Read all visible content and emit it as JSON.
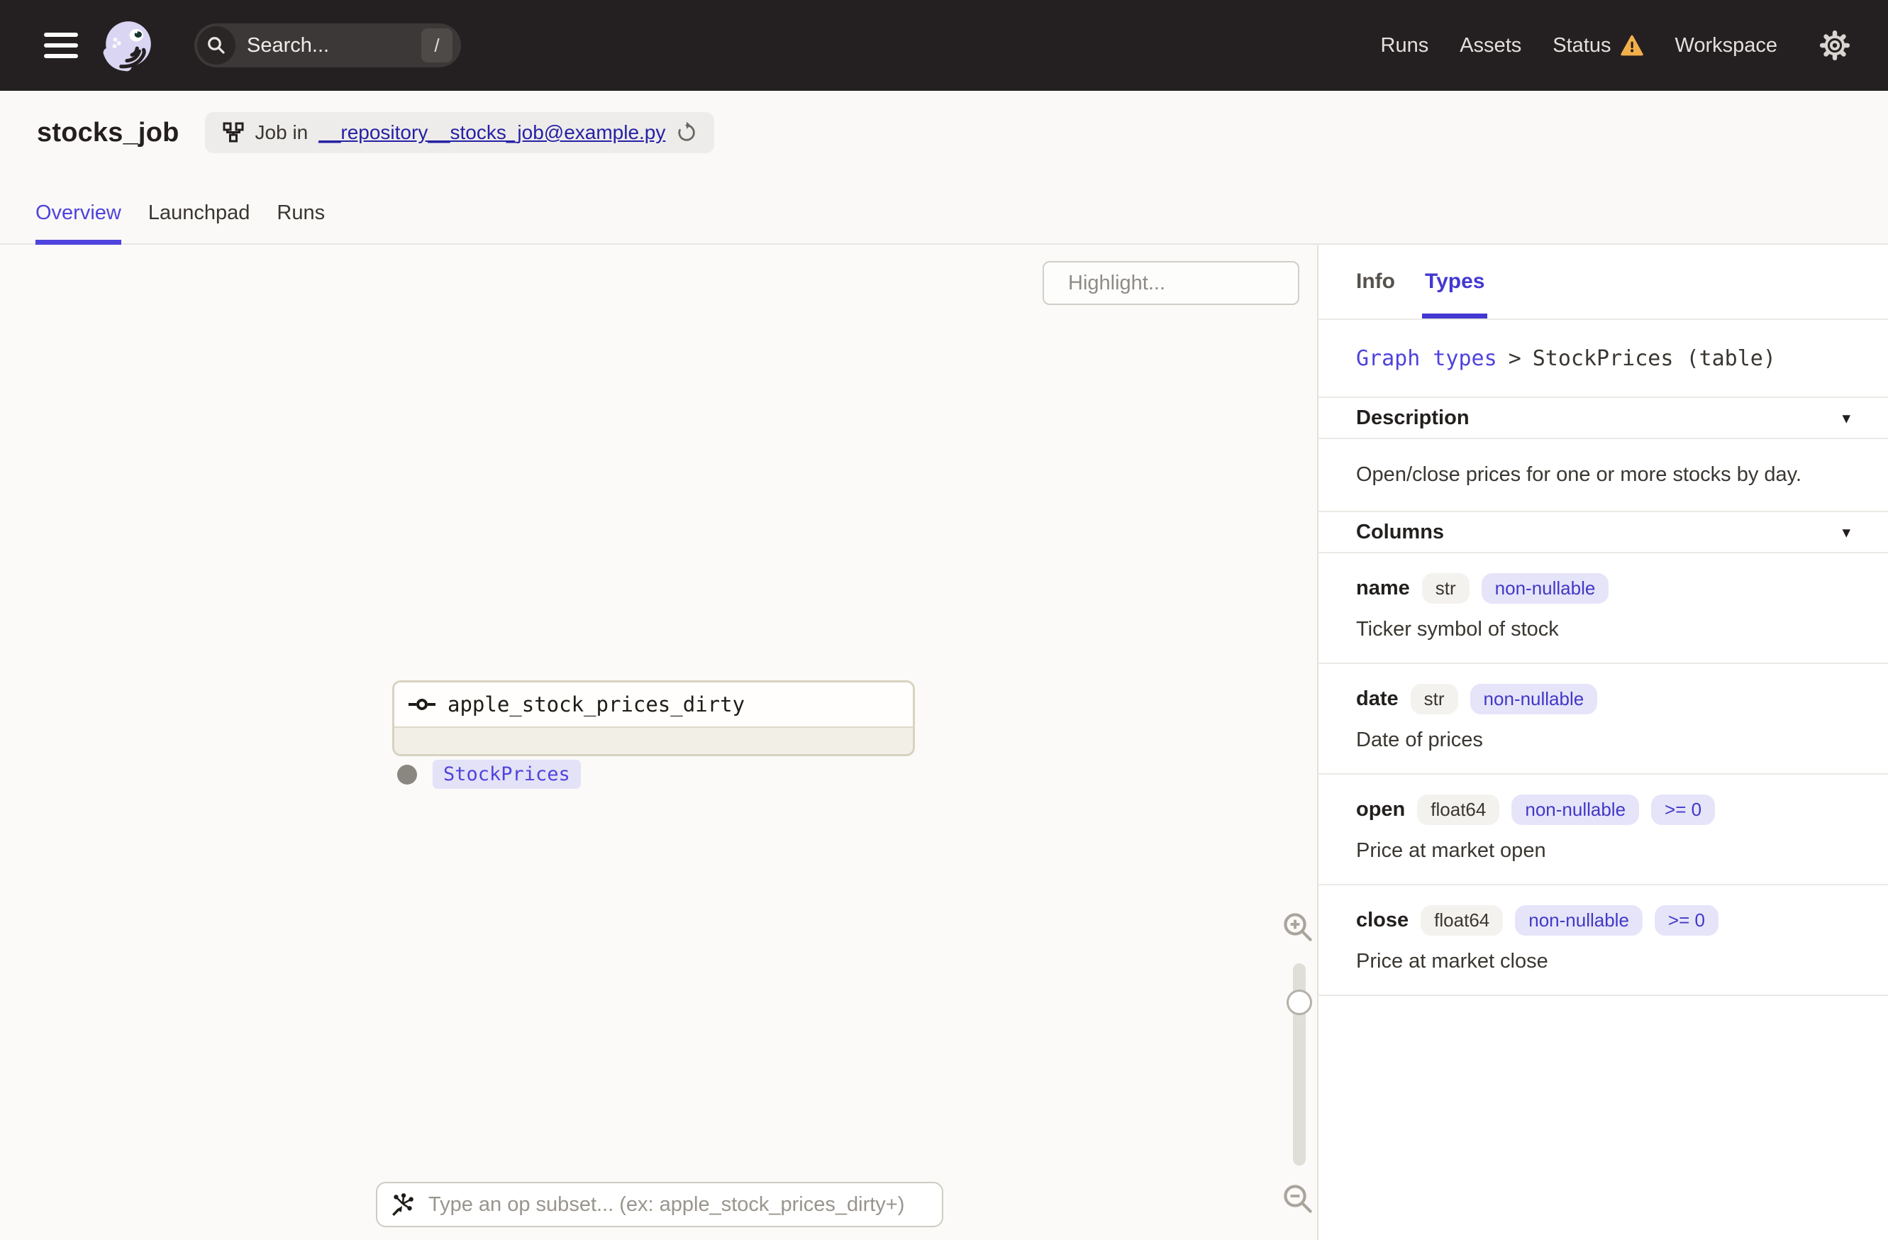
{
  "colors": {
    "accent": "#4F43DD",
    "warning": "#F2B04A",
    "nav_bg": "#242021",
    "link": "#2721A5"
  },
  "nav": {
    "search": {
      "placeholder": "Search...",
      "shortcut_key": "/"
    },
    "items": [
      {
        "label": "Runs"
      },
      {
        "label": "Assets"
      },
      {
        "label": "Status",
        "has_warning": true
      },
      {
        "label": "Workspace"
      }
    ]
  },
  "header": {
    "title": "stocks_job",
    "job": {
      "prefix": "Job in",
      "link": "__repository__stocks_job@example.py"
    },
    "tabs": [
      {
        "label": "Overview",
        "active": true
      },
      {
        "label": "Launchpad",
        "active": false
      },
      {
        "label": "Runs",
        "active": false
      }
    ]
  },
  "canvas": {
    "highlight": {
      "placeholder": "Highlight..."
    },
    "node": {
      "title": "apple_stock_prices_dirty",
      "output_type": "StockPrices"
    },
    "op_subset": {
      "placeholder": "Type an op subset... (ex: apple_stock_prices_dirty+)"
    }
  },
  "panel": {
    "tabs": [
      {
        "label": "Info",
        "active": false
      },
      {
        "label": "Types",
        "active": true
      }
    ],
    "breadcrumb": {
      "link": "Graph types",
      "separator": ">",
      "current": "StockPrices (table)"
    },
    "description_section": {
      "title": "Description",
      "caret": "▾",
      "body": "Open/close prices for one or more stocks by day."
    },
    "columns_section": {
      "title": "Columns",
      "caret": "▾"
    },
    "columns": [
      {
        "name": "name",
        "type": "str",
        "constraints": [
          "non-nullable"
        ],
        "description": "Ticker symbol of stock"
      },
      {
        "name": "date",
        "type": "str",
        "constraints": [
          "non-nullable"
        ],
        "description": "Date of prices"
      },
      {
        "name": "open",
        "type": "float64",
        "constraints": [
          "non-nullable",
          ">= 0"
        ],
        "description": "Price at market open"
      },
      {
        "name": "close",
        "type": "float64",
        "constraints": [
          "non-nullable",
          ">= 0"
        ],
        "description": "Price at market close"
      }
    ]
  },
  "icons": {
    "hamburger": "menu-bars",
    "logo": "dagster-octopus",
    "search": "magnifier",
    "warning": "warning-triangle",
    "gear": "settings-gear",
    "job": "graph-fork",
    "refresh": "reload-arrow",
    "op_io": "io-port",
    "op_subset": "op-selector",
    "zoom_in": "magnifier-plus",
    "zoom_out": "magnifier-minus",
    "output_dot": "output-port"
  }
}
